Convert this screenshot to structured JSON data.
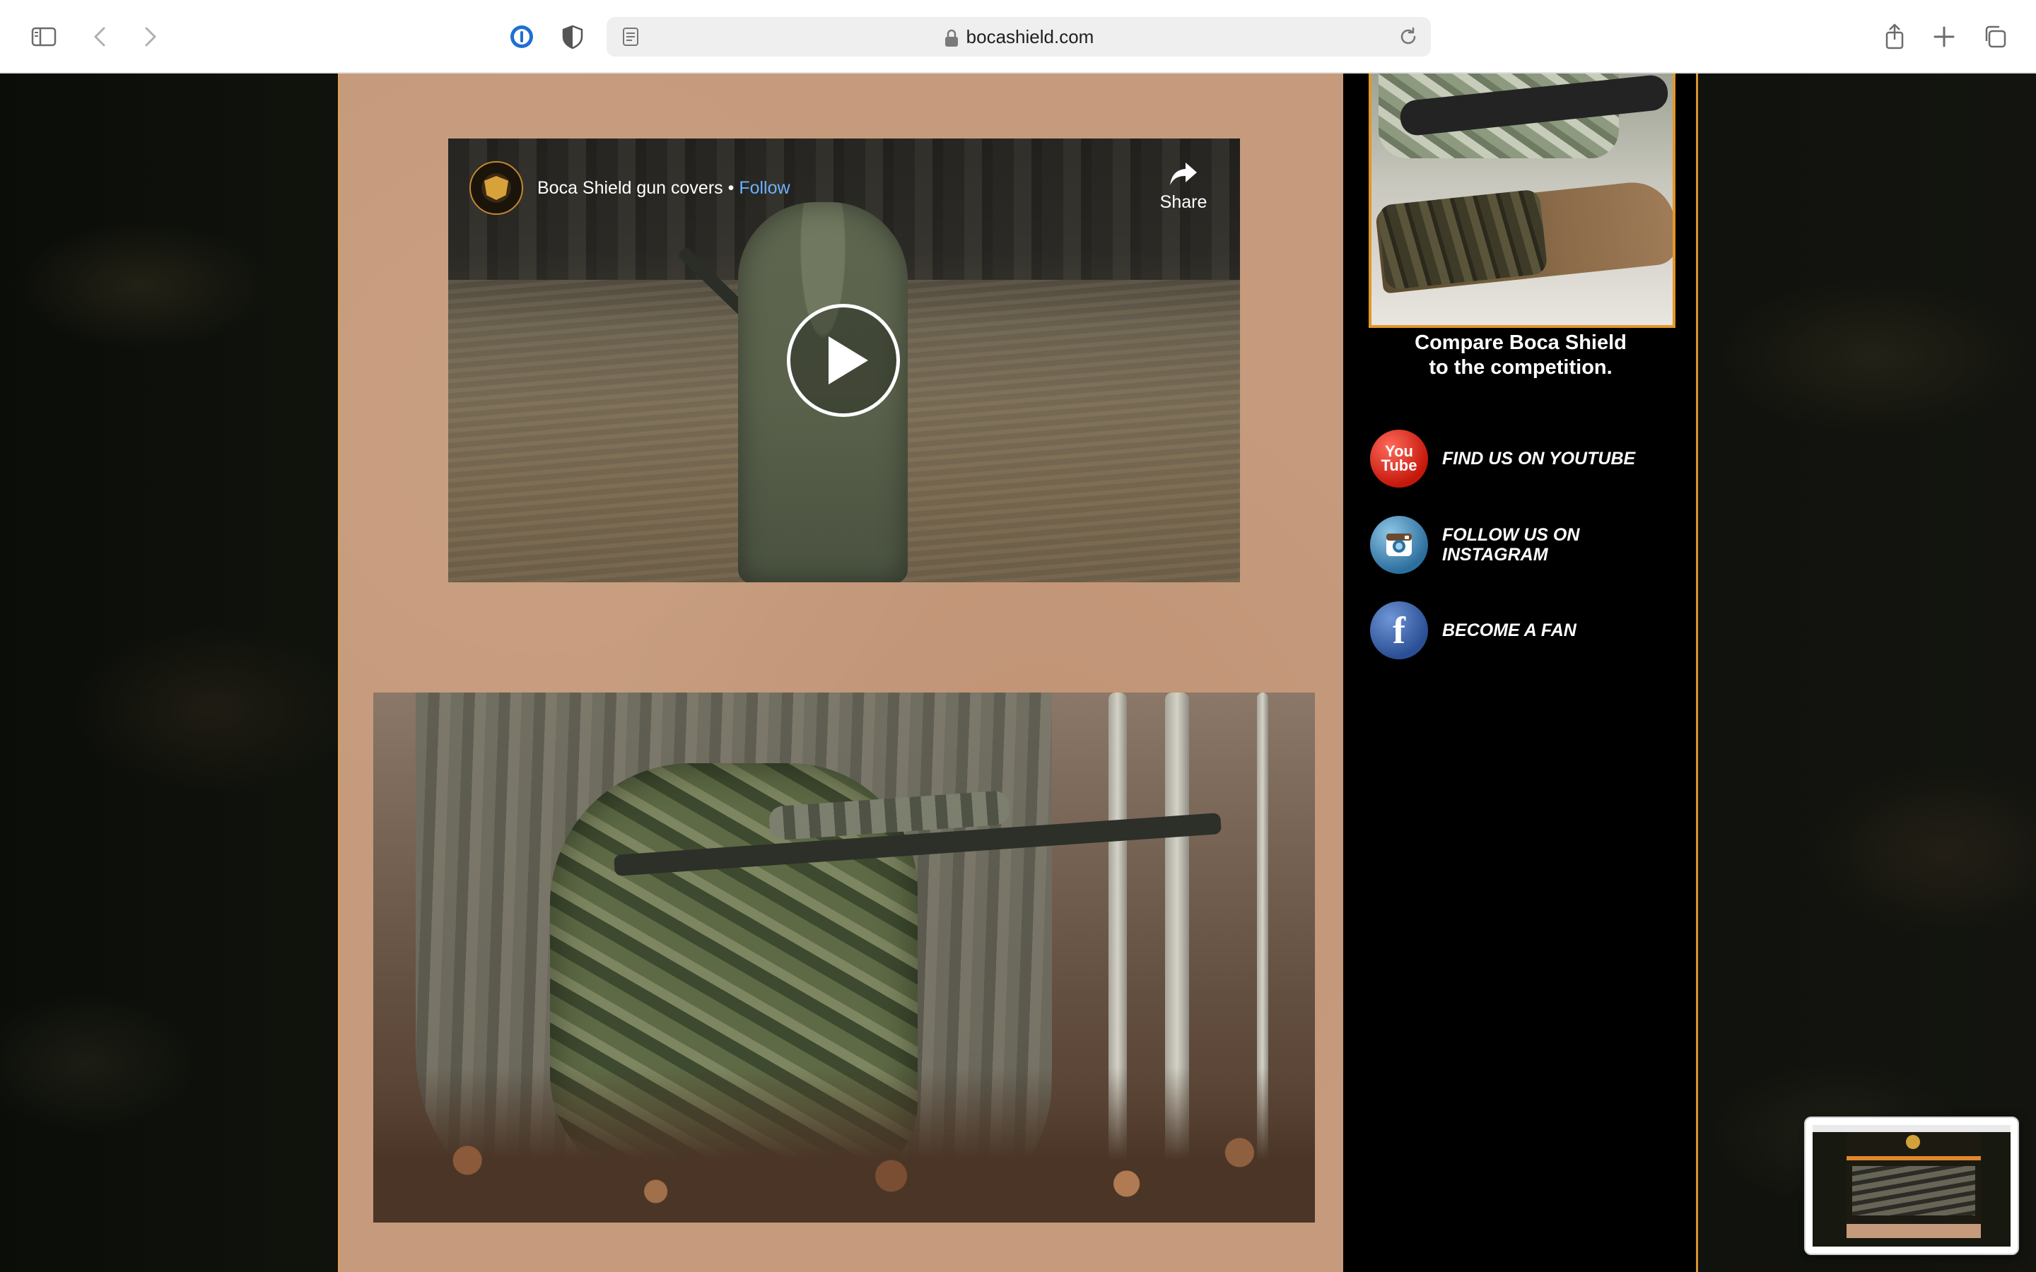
{
  "browser": {
    "url": "bocashield.com"
  },
  "video": {
    "channel_name": "Boca Shield gun covers",
    "separator": " • ",
    "follow_label": "Follow",
    "share_label": "Share"
  },
  "sidebar": {
    "compare_line1": "Compare Boca Shield",
    "compare_line2": "to the competition.",
    "social": [
      {
        "label": "FIND US ON YOUTUBE",
        "icon": "youtube-icon"
      },
      {
        "label_line1": "FOLLOW US ON",
        "label_line2": "INSTAGRAM",
        "icon": "instagram-icon"
      },
      {
        "label": "BECOME A FAN",
        "icon": "facebook-icon"
      }
    ],
    "youtube_icon_text1": "You",
    "youtube_icon_text2": "Tube",
    "facebook_icon_text": "f"
  },
  "colors": {
    "content_bg": "#c69a7c",
    "accent_border": "#e2a24a",
    "follow_link": "#6ab1ff",
    "sidebar_bg": "#000000"
  }
}
